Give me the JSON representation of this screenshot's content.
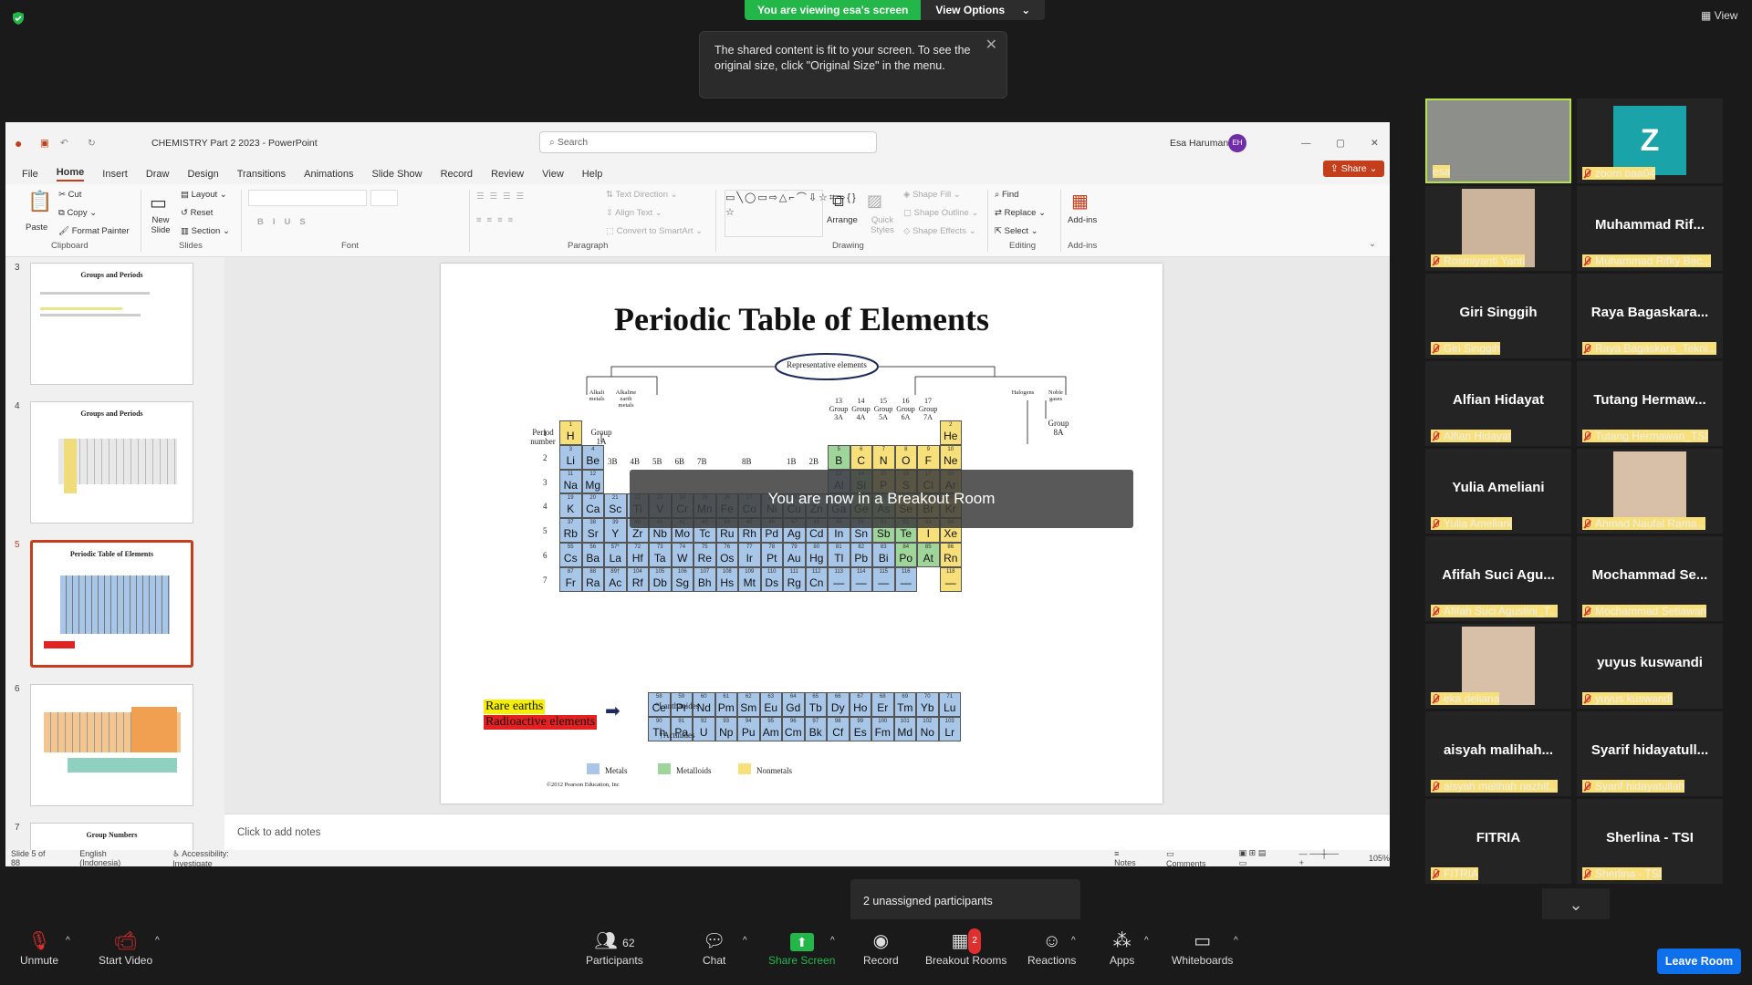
{
  "banner": {
    "viewing": "You are viewing esa's screen",
    "view_options": "View Options"
  },
  "tooltip": "The shared content is fit to your screen. To see the original size, click \"Original Size\" in the menu.",
  "view_label": "View",
  "ppt": {
    "doc_title": "CHEMISTRY Part 2 2023  -  PowerPoint",
    "search": "Search",
    "user": "Esa Haruman",
    "user_initials": "EH",
    "tabs": [
      "File",
      "Home",
      "Insert",
      "Draw",
      "Design",
      "Transitions",
      "Animations",
      "Slide Show",
      "Record",
      "Review",
      "View",
      "Help"
    ],
    "share": "Share",
    "ribbon": {
      "paste": "Paste",
      "cut": "Cut",
      "copy": "Copy",
      "format_painter": "Format Painter",
      "clipboard": "Clipboard",
      "new_slide": "New Slide",
      "layout": "Layout",
      "reset": "Reset",
      "section": "Section",
      "slides": "Slides",
      "font": "Font",
      "paragraph": "Paragraph",
      "text_direction": "Text Direction",
      "align_text": "Align Text",
      "convert": "Convert to SmartArt",
      "arrange": "Arrange",
      "quick_styles": "Quick Styles",
      "shape_fill": "Shape Fill",
      "shape_outline": "Shape Outline",
      "shape_effects": "Shape Effects",
      "drawing": "Drawing",
      "find": "Find",
      "replace": "Replace",
      "select": "Select",
      "editing": "Editing",
      "addins": "Add-ins",
      "addins_group": "Add-ins"
    },
    "thumbs": [
      {
        "num": "3",
        "title": "Groups and Periods"
      },
      {
        "num": "4",
        "title": "Groups and Periods"
      },
      {
        "num": "5",
        "title": "Periodic Table of Elements"
      },
      {
        "num": "6",
        "title": ""
      },
      {
        "num": "7",
        "title": "Group Numbers"
      }
    ],
    "notes_placeholder": "Click to add notes",
    "status": {
      "slide": "Slide 5 of 88",
      "lang": "English (Indonesia)",
      "access": "Accessibility: Investigate",
      "notes": "Notes",
      "comments": "Comments",
      "zoom": "105%"
    }
  },
  "slide": {
    "title": "Periodic Table of Elements",
    "rep": "Representative elements",
    "rare": "Rare earths",
    "radio": "Radioactive elements",
    "lanth": "*Lanthanides",
    "actin": "†Actinides",
    "legend": [
      "Metals",
      "Metalloids",
      "Nonmetals"
    ],
    "copyright": "©2012 Pearson Education, Inc",
    "period_label": "Period number",
    "alkali": "Alkali metals",
    "alkaline": "Alkaline earth metals",
    "halogens": "Halogens",
    "noble": "Noble gases",
    "group_1": "Group 1A",
    "group_18": "Group 8A",
    "groups_top": [
      "13 Group 3A",
      "14 Group 4A",
      "15 Group 5A",
      "16 Group 6A",
      "17 Group 7A"
    ],
    "trans_groups": [
      "3B",
      "4B",
      "5B",
      "6B",
      "7B",
      "8B",
      "1B",
      "2B"
    ],
    "periods": [
      "1",
      "2",
      "3",
      "4",
      "5",
      "6",
      "7"
    ],
    "grid": [
      [
        [
          "1",
          "H",
          "nm"
        ],
        null,
        null,
        null,
        null,
        null,
        null,
        null,
        null,
        null,
        null,
        null,
        null,
        null,
        null,
        null,
        null,
        [
          "2",
          "He",
          "nm"
        ]
      ],
      [
        [
          "3",
          "Li",
          "m"
        ],
        [
          "4",
          "Be",
          "m"
        ],
        null,
        null,
        null,
        null,
        null,
        null,
        null,
        null,
        null,
        null,
        [
          "5",
          "B",
          "md"
        ],
        [
          "6",
          "C",
          "nm"
        ],
        [
          "7",
          "N",
          "nm"
        ],
        [
          "8",
          "O",
          "nm"
        ],
        [
          "9",
          "F",
          "nm"
        ],
        [
          "10",
          "Ne",
          "nm"
        ]
      ],
      [
        [
          "11",
          "Na",
          "m"
        ],
        [
          "12",
          "Mg",
          "m"
        ],
        null,
        null,
        null,
        null,
        null,
        null,
        null,
        null,
        null,
        null,
        [
          "13",
          "Al",
          "m"
        ],
        [
          "14",
          "Si",
          "md"
        ],
        [
          "15",
          "P",
          "nm"
        ],
        [
          "16",
          "S",
          "nm"
        ],
        [
          "17",
          "Cl",
          "nm"
        ],
        [
          "18",
          "Ar",
          "nm"
        ]
      ],
      [
        [
          "19",
          "K",
          "m"
        ],
        [
          "20",
          "Ca",
          "m"
        ],
        [
          "21",
          "Sc",
          "m"
        ],
        [
          "22",
          "Ti",
          "m"
        ],
        [
          "23",
          "V",
          "m"
        ],
        [
          "24",
          "Cr",
          "m"
        ],
        [
          "25",
          "Mn",
          "m"
        ],
        [
          "26",
          "Fe",
          "m"
        ],
        [
          "27",
          "Co",
          "m"
        ],
        [
          "28",
          "Ni",
          "m"
        ],
        [
          "29",
          "Cu",
          "m"
        ],
        [
          "30",
          "Zn",
          "m"
        ],
        [
          "31",
          "Ga",
          "m"
        ],
        [
          "32",
          "Ge",
          "md"
        ],
        [
          "33",
          "As",
          "md"
        ],
        [
          "34",
          "Se",
          "nm"
        ],
        [
          "35",
          "Br",
          "nm"
        ],
        [
          "36",
          "Kr",
          "nm"
        ]
      ],
      [
        [
          "37",
          "Rb",
          "m"
        ],
        [
          "38",
          "Sr",
          "m"
        ],
        [
          "39",
          "Y",
          "m"
        ],
        [
          "40",
          "Zr",
          "m"
        ],
        [
          "41",
          "Nb",
          "m"
        ],
        [
          "42",
          "Mo",
          "m"
        ],
        [
          "43",
          "Tc",
          "m"
        ],
        [
          "44",
          "Ru",
          "m"
        ],
        [
          "45",
          "Rh",
          "m"
        ],
        [
          "46",
          "Pd",
          "m"
        ],
        [
          "47",
          "Ag",
          "m"
        ],
        [
          "48",
          "Cd",
          "m"
        ],
        [
          "49",
          "In",
          "m"
        ],
        [
          "50",
          "Sn",
          "m"
        ],
        [
          "51",
          "Sb",
          "md"
        ],
        [
          "52",
          "Te",
          "md"
        ],
        [
          "53",
          "I",
          "nm"
        ],
        [
          "54",
          "Xe",
          "nm"
        ]
      ],
      [
        [
          "55",
          "Cs",
          "m"
        ],
        [
          "56",
          "Ba",
          "m"
        ],
        [
          "57*",
          "La",
          "m"
        ],
        [
          "72",
          "Hf",
          "m"
        ],
        [
          "73",
          "Ta",
          "m"
        ],
        [
          "74",
          "W",
          "m"
        ],
        [
          "75",
          "Re",
          "m"
        ],
        [
          "76",
          "Os",
          "m"
        ],
        [
          "77",
          "Ir",
          "m"
        ],
        [
          "78",
          "Pt",
          "m"
        ],
        [
          "79",
          "Au",
          "m"
        ],
        [
          "80",
          "Hg",
          "m"
        ],
        [
          "81",
          "Tl",
          "m"
        ],
        [
          "82",
          "Pb",
          "m"
        ],
        [
          "83",
          "Bi",
          "m"
        ],
        [
          "84",
          "Po",
          "md"
        ],
        [
          "85",
          "At",
          "md"
        ],
        [
          "86",
          "Rn",
          "nm"
        ]
      ],
      [
        [
          "87",
          "Fr",
          "m"
        ],
        [
          "88",
          "Ra",
          "m"
        ],
        [
          "89†",
          "Ac",
          "m"
        ],
        [
          "104",
          "Rf",
          "m"
        ],
        [
          "105",
          "Db",
          "m"
        ],
        [
          "106",
          "Sg",
          "m"
        ],
        [
          "107",
          "Bh",
          "m"
        ],
        [
          "108",
          "Hs",
          "m"
        ],
        [
          "109",
          "Mt",
          "m"
        ],
        [
          "110",
          "Ds",
          "m"
        ],
        [
          "111",
          "Rg",
          "m"
        ],
        [
          "112",
          "Cn",
          "m"
        ],
        [
          "113",
          "—",
          "m"
        ],
        [
          "114",
          "—",
          "m"
        ],
        [
          "115",
          "—",
          "m"
        ],
        [
          "116",
          "—",
          "m"
        ],
        null,
        [
          "118",
          "—",
          "nm"
        ]
      ]
    ],
    "lanthanides": [
      [
        "58",
        "Ce"
      ],
      [
        "59",
        "Pr"
      ],
      [
        "60",
        "Nd"
      ],
      [
        "61",
        "Pm"
      ],
      [
        "62",
        "Sm"
      ],
      [
        "63",
        "Eu"
      ],
      [
        "64",
        "Gd"
      ],
      [
        "65",
        "Tb"
      ],
      [
        "66",
        "Dy"
      ],
      [
        "67",
        "Ho"
      ],
      [
        "68",
        "Er"
      ],
      [
        "69",
        "Tm"
      ],
      [
        "70",
        "Yb"
      ],
      [
        "71",
        "Lu"
      ]
    ],
    "actinides": [
      [
        "90",
        "Th"
      ],
      [
        "91",
        "Pa"
      ],
      [
        "92",
        "U"
      ],
      [
        "93",
        "Np"
      ],
      [
        "94",
        "Pu"
      ],
      [
        "95",
        "Am"
      ],
      [
        "96",
        "Cm"
      ],
      [
        "97",
        "Bk"
      ],
      [
        "98",
        "Cf"
      ],
      [
        "99",
        "Es"
      ],
      [
        "100",
        "Fm"
      ],
      [
        "101",
        "Md"
      ],
      [
        "102",
        "No"
      ],
      [
        "103",
        "Lr"
      ]
    ]
  },
  "breakout_msg": "You are now in a Breakout Room",
  "participants": [
    {
      "big": "",
      "name": "esa",
      "video": true,
      "muted": false,
      "active": true
    },
    {
      "big": "Z",
      "name": "zoom baa04",
      "video": false,
      "muted": true,
      "avatar": true
    },
    {
      "big": "",
      "name": "Rosmiyanti Yanti",
      "video": true,
      "muted": true
    },
    {
      "big": "Muhammad  Rif...",
      "name": "Muhammad Rifky Bac...",
      "muted": true
    },
    {
      "big": "Giri Singgih",
      "name": "Giri Singgih",
      "muted": true
    },
    {
      "big": "Raya  Bagaskara...",
      "name": "Raya Bagaskara_Tekni...",
      "muted": true
    },
    {
      "big": "Alfian Hidayat",
      "name": "Alfian Hidayat",
      "muted": true
    },
    {
      "big": "Tutang  Hermaw...",
      "name": "Tutang Hermawan_TSI",
      "muted": true
    },
    {
      "big": "Yulia Ameliani",
      "name": "Yulia Ameliani",
      "muted": true
    },
    {
      "big": "",
      "name": "Ahmad Naufal Rama...",
      "video": true,
      "muted": true
    },
    {
      "big": "Afifah Suci Agu...",
      "name": "Afifah Suci Agustini_T...",
      "muted": true
    },
    {
      "big": "Mochammad  Se...",
      "name": "Mochammad Setiawan",
      "muted": true
    },
    {
      "big": "",
      "name": "eka deliana",
      "video": true,
      "muted": true
    },
    {
      "big": "yuyus kuswandi",
      "name": "yuyus kuswandi",
      "muted": true
    },
    {
      "big": "aisyah  malihah...",
      "name": "aisyah malihah nazhif...",
      "muted": true
    },
    {
      "big": "Syarif  hidayatull...",
      "name": "Syarif hidayatullah",
      "muted": true
    },
    {
      "big": "FITRIA",
      "name": "FITRIA",
      "muted": true
    },
    {
      "big": "Sherlina - TSI",
      "name": "Sherlina - TSI",
      "muted": true
    }
  ],
  "unassigned": "2 unassigned participants",
  "toolbar": {
    "unmute": "Unmute",
    "start_video": "Start Video",
    "participants": "Participants",
    "participants_count": "62",
    "chat": "Chat",
    "share_screen": "Share Screen",
    "record": "Record",
    "breakout": "Breakout Rooms",
    "breakout_badge": "2",
    "reactions": "Reactions",
    "apps": "Apps",
    "whiteboards": "Whiteboards",
    "leave": "Leave Room"
  }
}
